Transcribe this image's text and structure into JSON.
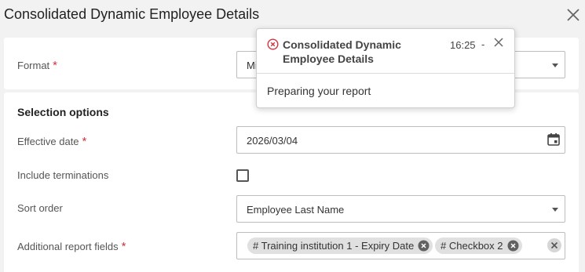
{
  "dialog": {
    "title": "Consolidated Dynamic Employee Details",
    "close_icon": "close-icon"
  },
  "format": {
    "label": "Format",
    "required_mark": "*",
    "value": "Mi"
  },
  "selection": {
    "section_title": "Selection options",
    "effective_date": {
      "label": "Effective date",
      "required_mark": "*",
      "value": "2026/03/04",
      "icon": "calendar-icon"
    },
    "include_terminations": {
      "label": "Include terminations",
      "checked": false
    },
    "sort_order": {
      "label": "Sort order",
      "value": "Employee Last Name"
    },
    "additional_fields": {
      "label": "Additional report fields",
      "required_mark": "*",
      "chips": [
        "# Training institution 1 - Expiry Date",
        "# Checkbox 2"
      ]
    }
  },
  "toast": {
    "status_icon": "error-circle-icon",
    "title": "Consolidated Dynamic Employee Details",
    "time": "16:25",
    "dash": "-",
    "message": "Preparing your report"
  },
  "colors": {
    "required": "#d0343f",
    "error_icon": "#d0343f",
    "chip_bg": "#e0e0e0"
  }
}
